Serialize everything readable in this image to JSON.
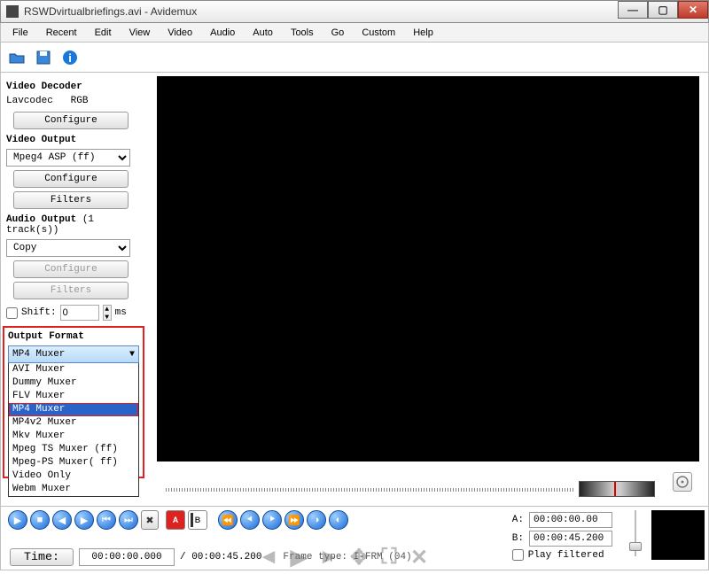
{
  "window": {
    "filename": "RSWDvirtualbriefings.avi",
    "appname": "Avidemux"
  },
  "menu": [
    "File",
    "Recent",
    "Edit",
    "View",
    "Video",
    "Audio",
    "Auto",
    "Tools",
    "Go",
    "Custom",
    "Help"
  ],
  "sidebar": {
    "video_decoder": {
      "title": "Video Decoder",
      "codec": "Lavcodec",
      "color": "RGB",
      "configure": "Configure"
    },
    "video_output": {
      "title": "Video Output",
      "selected": "Mpeg4 ASP (ff)",
      "configure": "Configure",
      "filters": "Filters"
    },
    "audio_output": {
      "title": "Audio Output",
      "tracks": "(1 track(s))",
      "selected": "Copy",
      "configure": "Configure",
      "filters": "Filters",
      "shift_label": "Shift:",
      "shift_value": "0",
      "shift_unit": "ms"
    },
    "output_format": {
      "title": "Output Format",
      "selected": "MP4 Muxer",
      "options": [
        "AVI Muxer",
        "Dummy Muxer",
        "FLV Muxer",
        "MP4 Muxer",
        "MP4v2 Muxer",
        "Mkv Muxer",
        "Mpeg TS Muxer (ff)",
        "Mpeg-PS Muxer( ff)",
        "Video Only",
        "Webm Muxer"
      ]
    }
  },
  "timeline": {
    "a_label": "A:",
    "a_value": "00:00:00.00",
    "b_label": "B:",
    "b_value": "00:00:45.200",
    "play_filtered": "Play filtered"
  },
  "bottom": {
    "time_btn": "Time:",
    "time_value": "00:00:00.000",
    "duration": "/ 00:00:45.200",
    "frame_type": "Frame type: I-FRM (04)"
  }
}
